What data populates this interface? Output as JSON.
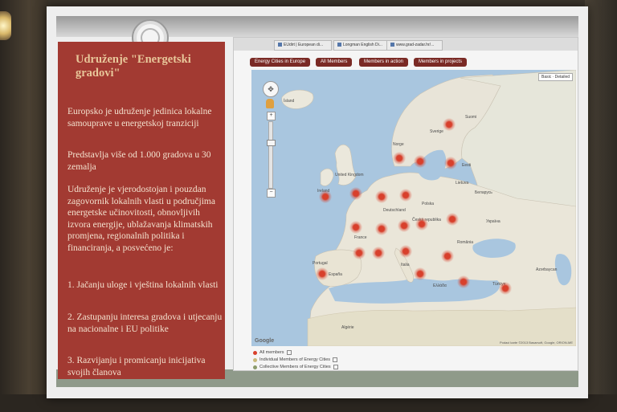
{
  "slide": {
    "title": "Udruženje \"Energetski gradovi\"",
    "para1": "Europsko je udruženje jedinica lokalne samouprave u energetskoj tranziciji",
    "para2": "Predstavlja više od 1.000 gradova u 30 zemalja",
    "para3": "Udruženje je vjerodostojan i pouzdan zagovornik lokalnih vlasti u područjima energetske učinovitosti, obnovljivih izvora energije, ublažavanja klimatskih promjena, regionalnih politika i financiranja, a posvećeno je:",
    "list1": "1. Jačanju uloge i vještina lokalnih vlasti",
    "list2": "2. Zastupanju interesa gradova i utjecanju na nacionalne i EU politike",
    "list3": "3. Razvijanju i promicanju inicijativa svojih članova"
  },
  "browser": {
    "tabs": [
      "EUdirt | European di...",
      "Longman English Di...",
      "www.grad-zadar.hr/..."
    ]
  },
  "page": {
    "nav": [
      "Energy Cities in Europe",
      "All Members",
      "Members in action",
      "Members in projects"
    ]
  },
  "map": {
    "type_label": "Basic · Detailed",
    "labels": {
      "island": "Ísland",
      "sverige": "Sverige",
      "norge": "Norge",
      "suomi": "Suomi",
      "eesti": "Eesti",
      "lietuva": "Lietuva",
      "uk": "United Kingdom",
      "ireland": "Ireland",
      "deutschland": "Deutschland",
      "polska": "Polska",
      "belarus": "Беларусь",
      "cesko": "Česká republika",
      "ukraina": "Україна",
      "france": "France",
      "romania": "România",
      "italia": "Italia",
      "espana": "España",
      "portugal": "Portugal",
      "turkiye": "Türkiye",
      "ellada": "Ελλάδα",
      "algerie": "Algérie",
      "azerbaijan": "Azərbaycan"
    },
    "copyright": "Podaci karte ©2013 Basarsoft, Google, ORION-ME",
    "google": "Google"
  },
  "legend": {
    "all": "All members",
    "individual": "Individual Members of Energy Cities",
    "collective": "Collective Members of Energy Cities"
  },
  "colors": {
    "panel_red": "#a23a32",
    "marker": "#d8402c",
    "nav_tab": "#7a2a25"
  }
}
